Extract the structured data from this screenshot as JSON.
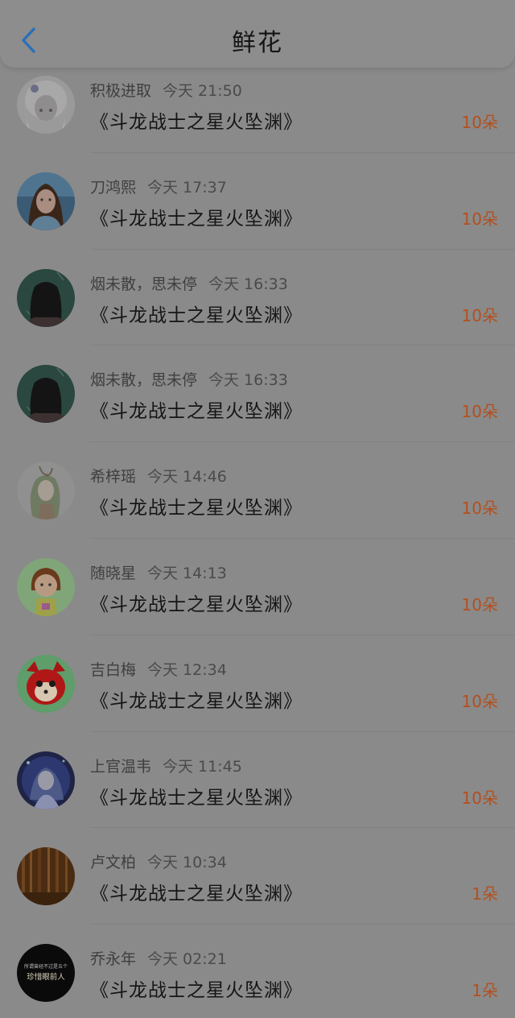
{
  "header": {
    "title": "鲜花",
    "back_icon": "chevron-left-icon",
    "accent": "#2a6fb8"
  },
  "colors": {
    "count": "#b2501f",
    "overlay": "#8a8a8a"
  },
  "rows": [
    {
      "name": "积极进取",
      "time": "今天 21:50",
      "book": "《斗龙战士之星火坠渊》",
      "count": "10朵",
      "avatar": "anime-girl-white-hair-avatar"
    },
    {
      "name": "刀鸿熙",
      "time": "今天 17:37",
      "book": "《斗龙战士之星火坠渊》",
      "count": "10朵",
      "avatar": "girl-photo-avatar"
    },
    {
      "name": "烟未散，思未停",
      "time": "今天 16:33",
      "book": "《斗龙战士之星火坠渊》",
      "count": "10朵",
      "avatar": "long-hair-back-avatar"
    },
    {
      "name": "烟未散，思未停",
      "time": "今天 16:33",
      "book": "《斗龙战士之星火坠渊》",
      "count": "10朵",
      "avatar": "long-hair-back-avatar"
    },
    {
      "name": "希梓瑶",
      "time": "今天 14:46",
      "book": "《斗龙战士之星火坠渊》",
      "count": "10朵",
      "avatar": "anime-green-girl-avatar"
    },
    {
      "name": "随晓星",
      "time": "今天 14:13",
      "book": "《斗龙战士之星火坠渊》",
      "count": "10朵",
      "avatar": "cartoon-girl-avatar"
    },
    {
      "name": "吉白梅",
      "time": "今天 12:34",
      "book": "《斗龙战士之星火坠渊》",
      "count": "10朵",
      "avatar": "red-fox-avatar"
    },
    {
      "name": "上官温韦",
      "time": "今天 11:45",
      "book": "《斗龙战士之星火坠渊》",
      "count": "10朵",
      "avatar": "anime-blue-character-avatar"
    },
    {
      "name": "卢文柏",
      "time": "今天 10:34",
      "book": "《斗龙战士之星火坠渊》",
      "count": "1朵",
      "avatar": "forest-avatar"
    },
    {
      "name": "乔永年",
      "time": "今天 02:21",
      "book": "《斗龙战士之星火坠渊》",
      "count": "1朵",
      "avatar": "text-dark-avatar",
      "avatar_text": [
        "所谓曾经不过是五个",
        "珍惜眼前人"
      ]
    }
  ]
}
